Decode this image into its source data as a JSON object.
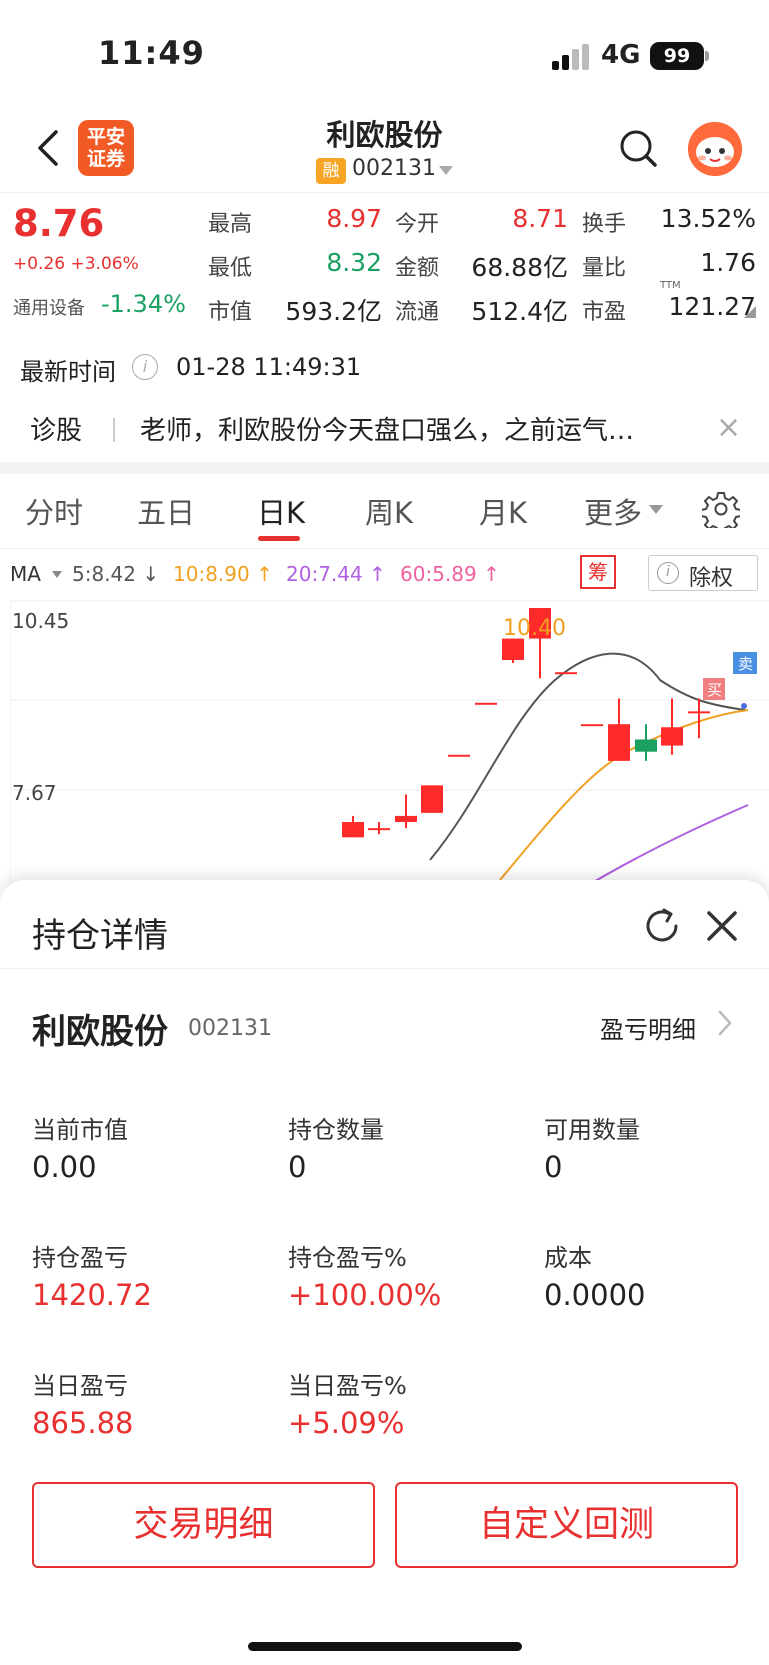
{
  "status_bar": {
    "time": "11:49",
    "network": "4G",
    "battery": "99"
  },
  "header": {
    "title": "利欧股份",
    "logo_line1": "平安",
    "logo_line2": "证券",
    "margin_tag": "融",
    "code": "002131"
  },
  "quote": {
    "price": "8.76",
    "change": "+0.26 +3.06%",
    "sector_name": "通用设备",
    "sector_change": "-1.34%",
    "stats": [
      {
        "label": "最高",
        "value": "8.97",
        "color": "red"
      },
      {
        "label": "今开",
        "value": "8.71",
        "color": "red"
      },
      {
        "label": "换手",
        "value": "13.52%",
        "color": "dark"
      },
      {
        "label": "最低",
        "value": "8.32",
        "color": "green"
      },
      {
        "label": "金额",
        "value": "68.88亿",
        "color": "dark"
      },
      {
        "label": "量比",
        "value": "1.76",
        "color": "dark"
      },
      {
        "label": "市值",
        "value": "593.2亿",
        "color": "dark"
      },
      {
        "label": "流通",
        "value": "512.4亿",
        "color": "dark"
      },
      {
        "label": "市盈",
        "value": "121.27",
        "color": "dark"
      }
    ],
    "ttm": "TTM"
  },
  "latest_time": {
    "label": "最新时间",
    "info": "i",
    "value": "01-28 11:49:31"
  },
  "diagnosis": {
    "label": "诊股",
    "text": "老师，利欧股份今天盘口强么，之前运气…",
    "close": "×"
  },
  "tabs": [
    {
      "label": "分时"
    },
    {
      "label": "五日"
    },
    {
      "label": "日K",
      "active": true
    },
    {
      "label": "周K"
    },
    {
      "label": "月K"
    },
    {
      "label": "更多"
    }
  ],
  "ma_bar": {
    "ma_label": "MA",
    "ma5": "5:8.42 ↓",
    "ma10": "10:8.90 ↑",
    "ma20": "20:7.44 ↑",
    "ma60": "60:5.89 ↑",
    "chou": "筹",
    "chuquan": "除权",
    "chuquan_info": "i",
    "colors": {
      "ma5": "#555555",
      "ma10": "#f0a020",
      "ma20": "#b060e0",
      "ma60": "#f060a0"
    }
  },
  "chart_data": {
    "type": "candlestick",
    "axis_labels": [
      "10.45",
      "7.67"
    ],
    "high_annotation": "10.40",
    "buy_marker": "买",
    "sell_marker": "卖",
    "candles": [
      {
        "o": 6.7,
        "c": 6.95,
        "h": 7.05,
        "l": 6.7
      },
      {
        "o": 6.85,
        "c": 6.85,
        "h": 6.95,
        "l": 6.75
      },
      {
        "o": 6.95,
        "c": 7.05,
        "h": 7.4,
        "l": 6.85
      },
      {
        "o": 7.1,
        "c": 7.55,
        "h": 7.55,
        "l": 7.1
      },
      {
        "o": 8.05,
        "c": 8.05,
        "h": 8.05,
        "l": 8.05
      },
      {
        "o": 8.9,
        "c": 8.9,
        "h": 8.9,
        "l": 8.9
      },
      {
        "o": 9.6,
        "c": 9.95,
        "h": 9.95,
        "l": 9.55
      },
      {
        "o": 9.95,
        "c": 10.45,
        "h": 10.45,
        "l": 9.3
      },
      {
        "o": 9.4,
        "c": 9.4,
        "h": 9.4,
        "l": 9.4
      },
      {
        "o": 8.55,
        "c": 8.55,
        "h": 8.55,
        "l": 8.55
      },
      {
        "o": 7.95,
        "c": 8.55,
        "h": 8.97,
        "l": 7.95
      },
      {
        "o": 8.3,
        "c": 8.1,
        "h": 8.55,
        "l": 7.95
      },
      {
        "o": 8.2,
        "c": 8.5,
        "h": 8.97,
        "l": 8.05
      },
      {
        "o": 8.76,
        "c": 8.76,
        "h": 8.97,
        "l": 8.32
      }
    ]
  },
  "sheet": {
    "title": "持仓详情",
    "stock_name": "利欧股份",
    "stock_code": "002131",
    "pnl_detail": "盈亏明细",
    "metrics": [
      {
        "label": "当前市值",
        "value": "0.00",
        "color": "dark"
      },
      {
        "label": "持仓数量",
        "value": "0",
        "color": "dark"
      },
      {
        "label": "可用数量",
        "value": "0",
        "color": "dark"
      },
      {
        "label": "持仓盈亏",
        "value": "1420.72",
        "color": "red"
      },
      {
        "label": "持仓盈亏%",
        "value": "+100.00%",
        "color": "red"
      },
      {
        "label": "成本",
        "value": "0.0000",
        "color": "dark"
      },
      {
        "label": "当日盈亏",
        "value": "865.88",
        "color": "red"
      },
      {
        "label": "当日盈亏%",
        "value": "+5.09%",
        "color": "red"
      }
    ],
    "buttons": {
      "trade_detail": "交易明细",
      "backtest": "自定义回测"
    }
  }
}
